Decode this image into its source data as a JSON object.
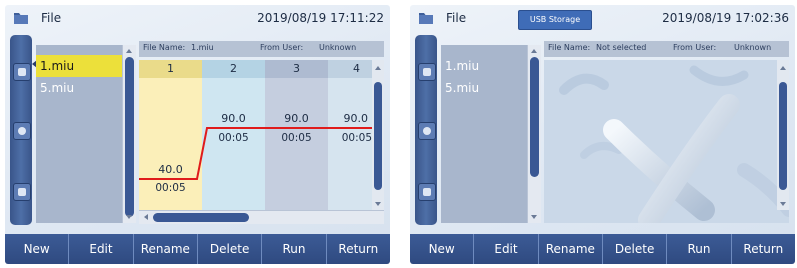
{
  "colors": {
    "accent": "#3a5894",
    "selected_file": "#ece03a",
    "profile_line": "#e01b1b",
    "step1_col": "#fbefb9",
    "step2_col": "#cfe6f1",
    "step3_col": "#c5cedf"
  },
  "left_screen": {
    "title": "File",
    "datetime": "2019/08/19 17:11:22",
    "files": [
      "1.miu",
      "5.miu"
    ],
    "selected_index": 0,
    "info": {
      "file_name_label": "File Name:",
      "file_name_value": "1.miu",
      "from_user_label": "From User:",
      "from_user_value": "Unknown"
    },
    "steps": [
      {
        "number": "1",
        "temperature": "40.0",
        "hold": "00:05"
      },
      {
        "number": "2",
        "temperature": "90.0",
        "hold": "00:05"
      },
      {
        "number": "3",
        "temperature": "90.0",
        "hold": "00:05"
      },
      {
        "number": "4",
        "temperature": "90.0",
        "hold": "00:05"
      }
    ],
    "buttons": [
      "New",
      "Edit",
      "Rename",
      "Delete",
      "Run",
      "Return"
    ]
  },
  "right_screen": {
    "title": "File",
    "usb_label": "USB Storage",
    "datetime": "2019/08/19 17:02:36",
    "files": [
      "1.miu",
      "5.miu"
    ],
    "info": {
      "file_name_label": "File Name:",
      "file_name_value": "Not selected",
      "from_user_label": "From User:",
      "from_user_value": "Unknown"
    },
    "buttons": [
      "New",
      "Edit",
      "Rename",
      "Delete",
      "Run",
      "Return"
    ]
  },
  "icons": {
    "title": "folder-icon",
    "rail": [
      "memory-card-icon",
      "usb-icon",
      "internal-storage-icon"
    ]
  }
}
